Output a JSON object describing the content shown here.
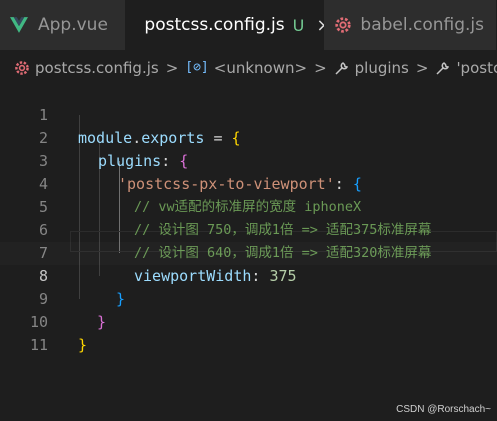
{
  "tabs": [
    {
      "label": "App.vue",
      "icon": "vue-icon",
      "active": false
    },
    {
      "label": "postcss.config.js",
      "icon": "gear-icon",
      "status": "U",
      "close": "×",
      "active": true
    },
    {
      "label": "babel.config.js",
      "icon": "gear-icon",
      "active": false
    }
  ],
  "breadcrumb": {
    "file": "postcss.config.js",
    "object_glyph": "[⊘]",
    "unknown": "<unknown>",
    "plugins": "plugins",
    "last": "'postcss-px-",
    "separator": ">"
  },
  "editor": {
    "current_line": 8,
    "lines": [
      {
        "n": "1"
      },
      {
        "n": "2"
      },
      {
        "n": "3"
      },
      {
        "n": "4"
      },
      {
        "n": "5"
      },
      {
        "n": "6"
      },
      {
        "n": "7"
      },
      {
        "n": "8"
      },
      {
        "n": "9"
      },
      {
        "n": "10"
      },
      {
        "n": "11"
      }
    ],
    "tokens": {
      "l1_module": "module",
      "l1_dot": ".",
      "l1_exports": "exports",
      "l1_eq": " = ",
      "l1_brace": "{",
      "l2_plugins": "plugins",
      "l2_colon": ": ",
      "l2_brace": "{",
      "l3_str": "'postcss-px-to-viewport'",
      "l3_colon": ": ",
      "l3_brace": "{",
      "l4_comment": "// vw适配的标准屏的宽度 iphoneX",
      "l5_comment": "// 设计图 750，调成1倍 => 适配375标准屏幕",
      "l6_comment": "// 设计图 640，调成1倍 => 适配320标准屏幕",
      "l7_prop": "viewportWidth",
      "l7_colon": ": ",
      "l7_num": "375",
      "l8_brace": "}",
      "l9_brace": "}",
      "l10_brace": "}"
    }
  },
  "watermark": "CSDN @Rorschach~",
  "colors": {
    "background": "#1e1e1e",
    "tabbar": "#252526",
    "string": "#ce9178",
    "comment": "#6a9955",
    "property": "#9cdcfe",
    "number": "#b5cea8",
    "bracket1": "#ffd700",
    "bracket2": "#da70d6",
    "bracket3": "#179fff",
    "untracked": "#73c991"
  }
}
